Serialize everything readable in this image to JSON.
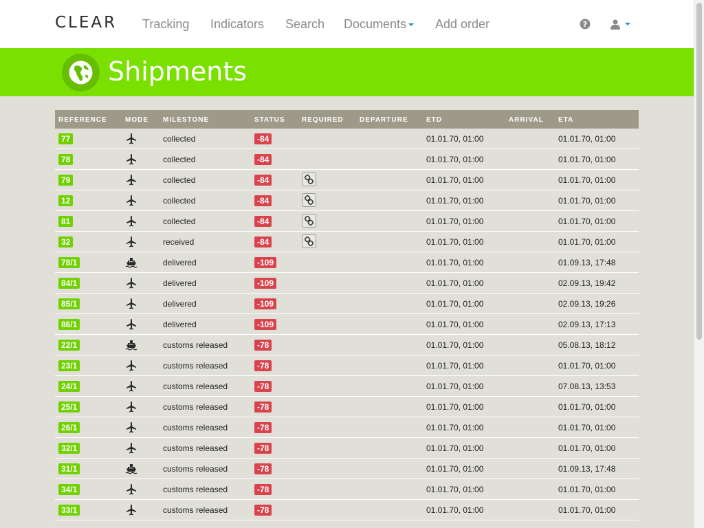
{
  "brand": "CLEAR",
  "nav": {
    "items": [
      "Tracking",
      "Indicators",
      "Search",
      "Documents",
      "Add order"
    ]
  },
  "header": {
    "title": "Shipments"
  },
  "table": {
    "columns": [
      "REFERENCE",
      "MODE",
      "MILESTONE",
      "STATUS",
      "REQUIRED",
      "DEPARTURE",
      "ETD",
      "ARRIVAL",
      "ETA"
    ],
    "rows": [
      {
        "ref": "77",
        "mode": "air",
        "milestone": "collected",
        "status": "-84",
        "required": false,
        "etd": "01.01.70, 01:00",
        "eta": "01.01.70, 01:00"
      },
      {
        "ref": "78",
        "mode": "air",
        "milestone": "collected",
        "status": "-84",
        "required": false,
        "etd": "01.01.70, 01:00",
        "eta": "01.01.70, 01:00"
      },
      {
        "ref": "79",
        "mode": "air",
        "milestone": "collected",
        "status": "-84",
        "required": true,
        "etd": "01.01.70, 01:00",
        "eta": "01.01.70, 01:00"
      },
      {
        "ref": "12",
        "mode": "air",
        "milestone": "collected",
        "status": "-84",
        "required": true,
        "etd": "01.01.70, 01:00",
        "eta": "01.01.70, 01:00"
      },
      {
        "ref": "81",
        "mode": "air",
        "milestone": "collected",
        "status": "-84",
        "required": true,
        "etd": "01.01.70, 01:00",
        "eta": "01.01.70, 01:00"
      },
      {
        "ref": "32",
        "mode": "air",
        "milestone": "received",
        "status": "-84",
        "required": true,
        "etd": "01.01.70, 01:00",
        "eta": "01.01.70, 01:00"
      },
      {
        "ref": "78/1",
        "mode": "sea",
        "milestone": "delivered",
        "status": "-109",
        "required": false,
        "etd": "01.01.70, 01:00",
        "eta": "01.09.13, 17:48"
      },
      {
        "ref": "84/1",
        "mode": "air",
        "milestone": "delivered",
        "status": "-109",
        "required": false,
        "etd": "01.01.70, 01:00",
        "eta": "02.09.13, 19:42"
      },
      {
        "ref": "85/1",
        "mode": "air",
        "milestone": "delivered",
        "status": "-109",
        "required": false,
        "etd": "01.01.70, 01:00",
        "eta": "02.09.13, 19:26"
      },
      {
        "ref": "86/1",
        "mode": "air",
        "milestone": "delivered",
        "status": "-109",
        "required": false,
        "etd": "01.01.70, 01:00",
        "eta": "02.09.13, 17:13"
      },
      {
        "ref": "22/1",
        "mode": "sea",
        "milestone": "customs released",
        "status": "-78",
        "required": false,
        "etd": "01.01.70, 01:00",
        "eta": "05.08.13, 18:12"
      },
      {
        "ref": "23/1",
        "mode": "air",
        "milestone": "customs released",
        "status": "-78",
        "required": false,
        "etd": "01.01.70, 01:00",
        "eta": "01.01.70, 01:00"
      },
      {
        "ref": "24/1",
        "mode": "air",
        "milestone": "customs released",
        "status": "-78",
        "required": false,
        "etd": "01.01.70, 01:00",
        "eta": "07.08.13, 13:53"
      },
      {
        "ref": "25/1",
        "mode": "air",
        "milestone": "customs released",
        "status": "-78",
        "required": false,
        "etd": "01.01.70, 01:00",
        "eta": "01.01.70, 01:00"
      },
      {
        "ref": "26/1",
        "mode": "air",
        "milestone": "customs released",
        "status": "-78",
        "required": false,
        "etd": "01.01.70, 01:00",
        "eta": "01.01.70, 01:00"
      },
      {
        "ref": "32/1",
        "mode": "air",
        "milestone": "customs released",
        "status": "-78",
        "required": false,
        "etd": "01.01.70, 01:00",
        "eta": "01.01.70, 01:00"
      },
      {
        "ref": "31/1",
        "mode": "sea",
        "milestone": "customs released",
        "status": "-78",
        "required": false,
        "etd": "01.01.70, 01:00",
        "eta": "01.09.13, 17:48"
      },
      {
        "ref": "34/1",
        "mode": "air",
        "milestone": "customs released",
        "status": "-78",
        "required": false,
        "etd": "01.01.70, 01:00",
        "eta": "01.01.70, 01:00"
      },
      {
        "ref": "33/1",
        "mode": "air",
        "milestone": "customs released",
        "status": "-78",
        "required": false,
        "etd": "01.01.70, 01:00",
        "eta": "01.01.70, 01:00"
      }
    ]
  },
  "colors": {
    "accent_green": "#7ae000",
    "badge_green": "#6fd100",
    "badge_red": "#d9434c",
    "table_header": "#9d9a8a",
    "link_blue": "#1a8fd8"
  },
  "icons": {
    "help": "question-circle-icon",
    "user": "user-icon",
    "globe": "globe-icon",
    "air": "airplane-icon",
    "sea": "ship-icon",
    "required": "link-icon"
  }
}
